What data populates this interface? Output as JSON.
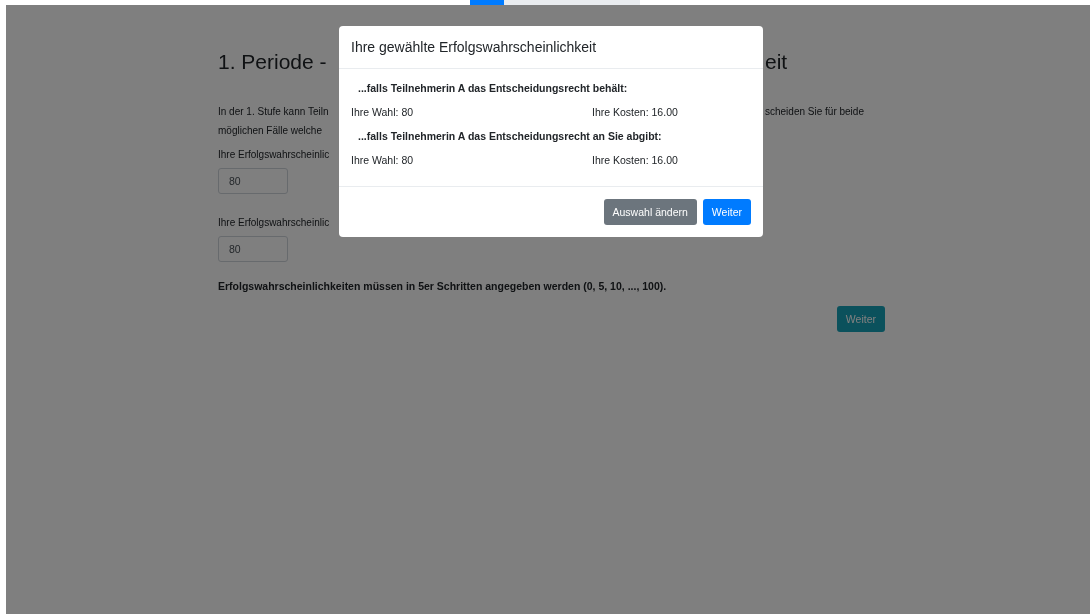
{
  "progress": {
    "level": 0.2
  },
  "page": {
    "heading_left": "1. Periode -",
    "heading_right": "eit",
    "intro_lines": [
      {
        "left": "In der 1. Stufe kann Teiln",
        "right": "scheiden Sie für beide"
      },
      {
        "left": "möglichen Fälle welche"
      }
    ],
    "fields": [
      {
        "label": "Ihre Erfolgswahrscheinlic",
        "value": "80"
      },
      {
        "label": "Ihre Erfolgswahrscheinlic",
        "value": "80"
      }
    ],
    "note": "Erfolgswahrscheinlichkeiten müssen in 5er Schritten angegeben werden (0, 5, 10, ..., 100).",
    "submit": "Weiter"
  },
  "dialog": {
    "title": "Ihre gewählte Erfolgswahrscheinlichkeit",
    "cases": [
      {
        "heading": "...falls Teilnehmerin A das Entscheidungsrecht behält:",
        "choice": "Ihre Wahl: 80",
        "cost": "Ihre Kosten: 16.00"
      },
      {
        "heading": "...falls Teilnehmerin A das Entscheidungsrecht an Sie abgibt:",
        "choice": "Ihre Wahl: 80",
        "cost": "Ihre Kosten: 16.00"
      }
    ],
    "buttons": [
      {
        "label": "Auswahl ändern",
        "kind": "secondary"
      },
      {
        "label": "Weiter",
        "kind": "primary"
      }
    ]
  }
}
